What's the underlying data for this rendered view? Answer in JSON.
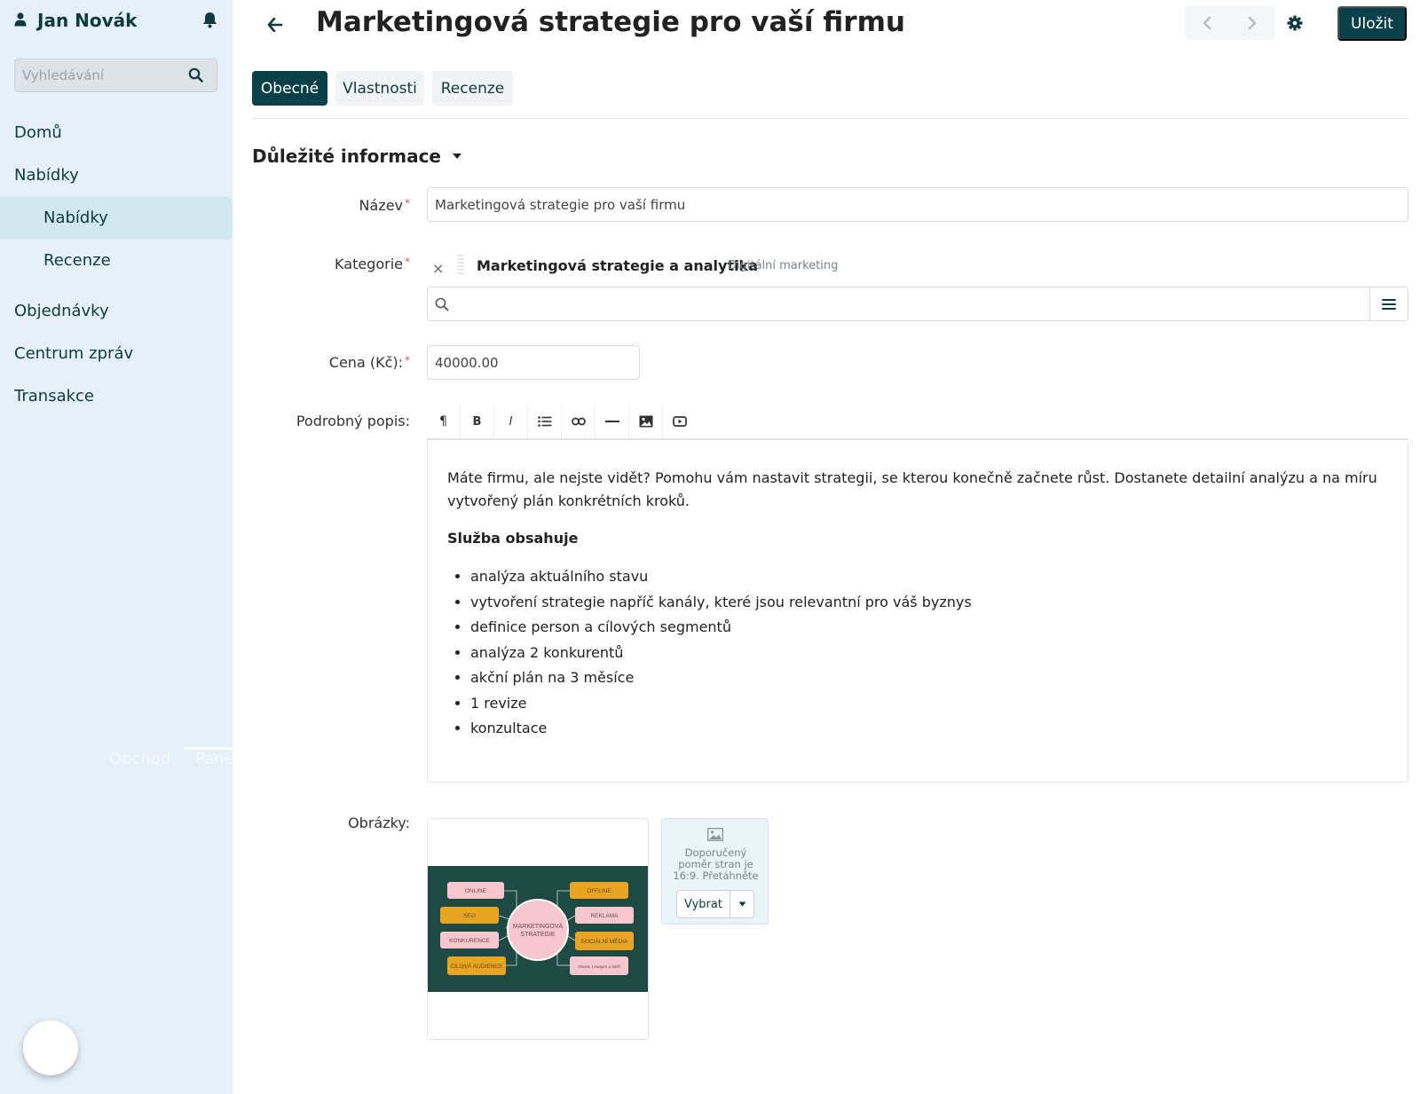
{
  "sidebar": {
    "user_name": "Jan Novák",
    "search_placeholder": "Vyhledávání",
    "nav": {
      "home": "Domů",
      "offers": "Nabídky",
      "offers_sub": "Nabídky",
      "reviews_sub": "Recenze",
      "orders": "Objednávky",
      "messages": "Centrum zpráv",
      "transactions": "Transakce"
    },
    "ghost_left": "Obchod",
    "ghost_right": "Pane"
  },
  "header": {
    "title": "Marketingová strategie pro vaší firmu",
    "save_label": "Uložit"
  },
  "tabs": [
    {
      "label": "Obecné",
      "active": true
    },
    {
      "label": "Vlastnosti",
      "active": false
    },
    {
      "label": "Recenze",
      "active": false
    }
  ],
  "section": {
    "title": "Důležité informace"
  },
  "form": {
    "name_label": "Název",
    "name_value": "Marketingová strategie pro vaší firmu",
    "category_label": "Kategorie",
    "category_remove": "×",
    "category_name": "Marketingová strategie a analytika",
    "category_parent": "Digitální marketing",
    "price_label": "Cena (Kč):",
    "price_value": "40000.00",
    "description_label": "Podrobný popis:",
    "images_label": "Obrázky:",
    "required_mark": "*"
  },
  "editor": {
    "toolbar": [
      "¶",
      "B",
      "I",
      "list-icon",
      "link-icon",
      "hr-icon",
      "image-icon",
      "video-icon"
    ],
    "intro": "Máte firmu, ale nejste vidět? Pomohu vám nastavit strategii, se kterou konečně začnete růst. Dostanete detailní analýzu a na míru vytvořený plán konkrétních kroků.",
    "heading": "Služba obsahuje",
    "items": [
      "analýza aktuálního stavu",
      "vytvoření strategie napříč kanály, které jsou relevantní pro váš byznys",
      "definice person a cílových segmentů",
      "analýza 2 konkurentů",
      "akční plán na 3 měsíce",
      "1 revize",
      "konzultace"
    ]
  },
  "images": {
    "upload_hint": "Doporučený poměr stran je 16:9. Přetáhněte",
    "pick_label": "Vybrat",
    "thumbnail": {
      "center": [
        "MARKETINGOVÁ",
        "STRATEGIE"
      ],
      "left_boxes": [
        "ONLINE",
        "SEO",
        "KONKURENCE",
        "CÍLOVÁ AUDIENCE"
      ],
      "right_boxes": [
        "OFFLINE",
        "REKLAMA",
        "SOCIÁLNÍ MÉDIA",
        "Obsah, Leadgen a další"
      ]
    }
  },
  "colors": {
    "brand": "#0b4048",
    "sidebar_bg": "#e6f0f8",
    "active_nav": "#d2e8f1",
    "required": "#d9534f"
  }
}
